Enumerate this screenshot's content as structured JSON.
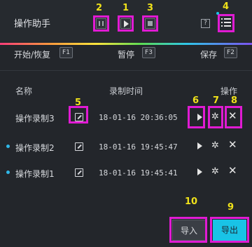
{
  "header": {
    "title": "操作助手",
    "pause_icon": "pause-icon",
    "play_icon": "play-icon",
    "stop_icon": "stop-icon",
    "help_label": "?",
    "menu_icon": "menu-list-icon"
  },
  "hotkeys": [
    {
      "label": "开始/恢复",
      "key": "F1"
    },
    {
      "label": "暂停",
      "key": "F3"
    },
    {
      "label": "保存",
      "key": "F2"
    }
  ],
  "table": {
    "columns": {
      "name": "名称",
      "time": "录制时间",
      "action": "操作"
    },
    "rows": [
      {
        "name": "操作录制3",
        "time": "18-01-16 20:36:05",
        "dot": false
      },
      {
        "name": "操作录制2",
        "time": "18-01-16 19:45:47",
        "dot": true
      },
      {
        "name": "操作录制1",
        "time": "18-01-16 19:45:41",
        "dot": true
      }
    ]
  },
  "buttons": {
    "import": "导入",
    "export": "导出"
  },
  "annotations": {
    "n1": "1",
    "n2": "2",
    "n3": "3",
    "n4": "4",
    "n5": "5",
    "n6": "6",
    "n7": "7",
    "n8": "8",
    "n9": "9",
    "n10": "10"
  },
  "colors": {
    "accent": "#19c3e6",
    "highlight": "#e01bd3",
    "annotation": "#f0e21a"
  }
}
